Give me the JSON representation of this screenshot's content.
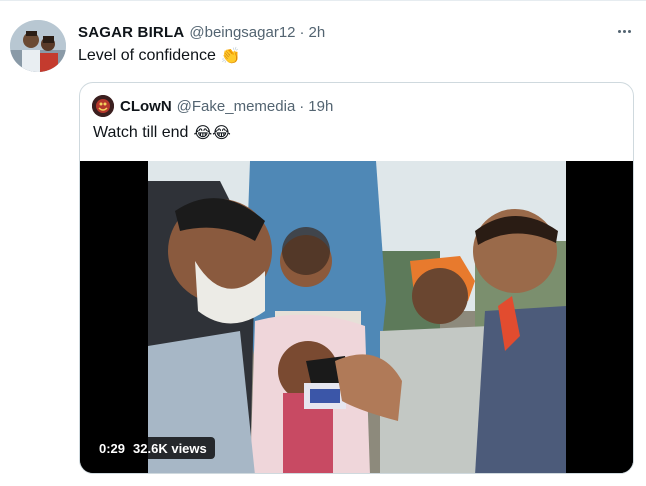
{
  "tweet": {
    "display_name": "SAGAR BIRLA",
    "handle": "@beingsagar12",
    "separator": "·",
    "time": "2h",
    "text": "Level of confidence",
    "emoji": "👏"
  },
  "quoted_tweet": {
    "display_name": "CLowN",
    "handle": "@Fake_memedia",
    "separator": "·",
    "time": "19h",
    "text": "Watch till end",
    "emoji": "😂😂"
  },
  "video": {
    "duration": "0:29",
    "views": "32.6K views"
  },
  "icons": {
    "more": "more-options-icon",
    "clap": "clapping-hands-emoji",
    "laugh": "tears-of-joy-emoji"
  },
  "colors": {
    "text_primary": "#0f1419",
    "text_secondary": "#536471",
    "card_border": "#cfd9de"
  }
}
